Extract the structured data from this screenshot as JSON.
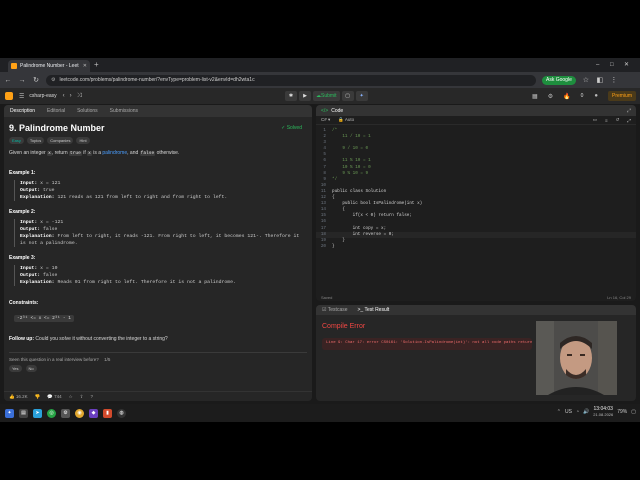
{
  "browser": {
    "tab_title": "Palindrome Number - Leet",
    "tab_close": "✕",
    "new_tab": "+",
    "url": "leetcode.com/problems/palindrome-number/?envType=problem-list-v2&envId=dh2wta1c",
    "ask_google": "Ask Google",
    "window_controls": [
      "–",
      "□",
      "✕"
    ]
  },
  "app_header": {
    "list_name": "csharp-easy",
    "submit_label": "Submit",
    "counter": "0",
    "premium_label": "Premium"
  },
  "left_tabs": [
    "Description",
    "Editorial",
    "Solutions",
    "Submissions"
  ],
  "problem": {
    "title": "9. Palindrome Number",
    "status": "Solved",
    "tags": [
      "Easy",
      "Topics",
      "Companies",
      "Hint"
    ],
    "desc_pre": "Given an integer",
    "desc_x": "x",
    "desc_mid": ", return",
    "desc_true": "true",
    "desc_if": "if",
    "desc_x2": "x",
    "desc_is": "is a",
    "desc_link": "palindrome",
    "desc_and": ", and",
    "desc_false": "false",
    "desc_end": "otherwise.",
    "examples": [
      {
        "title": "Example 1:",
        "input": "x = 121",
        "output": "true",
        "explanation": "121 reads as 121 from left to right and from right to left."
      },
      {
        "title": "Example 2:",
        "input": "x = -121",
        "output": "false",
        "explanation": "From left to right, it reads -121. From right to left, it becomes 121-. Therefore it is not a palindrome."
      },
      {
        "title": "Example 3:",
        "input": "x = 10",
        "output": "false",
        "explanation": "Reads 01 from right to left. Therefore it is not a palindrome."
      }
    ],
    "labels": {
      "input": "Input:",
      "output": "Output:",
      "explanation": "Explanation:"
    },
    "constraints_title": "Constraints:",
    "constraint": "-2³¹ <= x <= 2³¹ - 1",
    "followup_label": "Follow up:",
    "followup_text": "Could you solve it without converting the integer to a string?",
    "seen_q": "Seen this question in a real interview before?",
    "seen_count": "1/5",
    "yes": "Yes",
    "no": "No",
    "footer": {
      "likes": "16.2K",
      "comments": "744"
    }
  },
  "code_panel": {
    "title": "Code",
    "language": "C#",
    "mode": "Auto",
    "status_left": "Saved",
    "status_right": "Ln 16, Col 29",
    "lines": [
      {
        "n": "1",
        "t": "/*",
        "c": true
      },
      {
        "n": "2",
        "t": "    11 / 10 = 1",
        "c": true
      },
      {
        "n": "3",
        "t": "",
        "c": true
      },
      {
        "n": "4",
        "t": "    9 / 10 = 0",
        "c": true
      },
      {
        "n": "5",
        "t": "",
        "c": true
      },
      {
        "n": "6",
        "t": "    11 % 10 = 1",
        "c": true
      },
      {
        "n": "7",
        "t": "    10 % 10 = 0",
        "c": true
      },
      {
        "n": "8",
        "t": "    9 % 10 = 9",
        "c": true
      },
      {
        "n": "9",
        "t": "*/",
        "c": true
      },
      {
        "n": "10",
        "t": "",
        "c": false
      },
      {
        "n": "11",
        "t": "public class Solution",
        "c": false
      },
      {
        "n": "12",
        "t": "{",
        "c": false
      },
      {
        "n": "13",
        "t": "    public bool IsPalindrome(int x)",
        "c": false
      },
      {
        "n": "14",
        "t": "    {",
        "c": false
      },
      {
        "n": "15",
        "t": "        if(x < 0) return false;",
        "c": false
      },
      {
        "n": "16",
        "t": "",
        "c": false
      },
      {
        "n": "17",
        "t": "        int copy = x;",
        "c": false
      },
      {
        "n": "18",
        "t": "        int reverse = 0;",
        "c": false
      },
      {
        "n": "19",
        "t": "    }",
        "c": false
      },
      {
        "n": "20",
        "t": "}",
        "c": false
      }
    ]
  },
  "result_panel": {
    "tabs": [
      "Testcase",
      "Test Result"
    ],
    "error_title": "Compile Error",
    "error_msg": "Line 9: Char 17: error CS0161: 'Solution.IsPalindrome(int)': not all code paths return a value"
  },
  "taskbar": {
    "time": "13:04:03",
    "date": "21.08.2026",
    "lang": "US",
    "battery": "79%"
  }
}
